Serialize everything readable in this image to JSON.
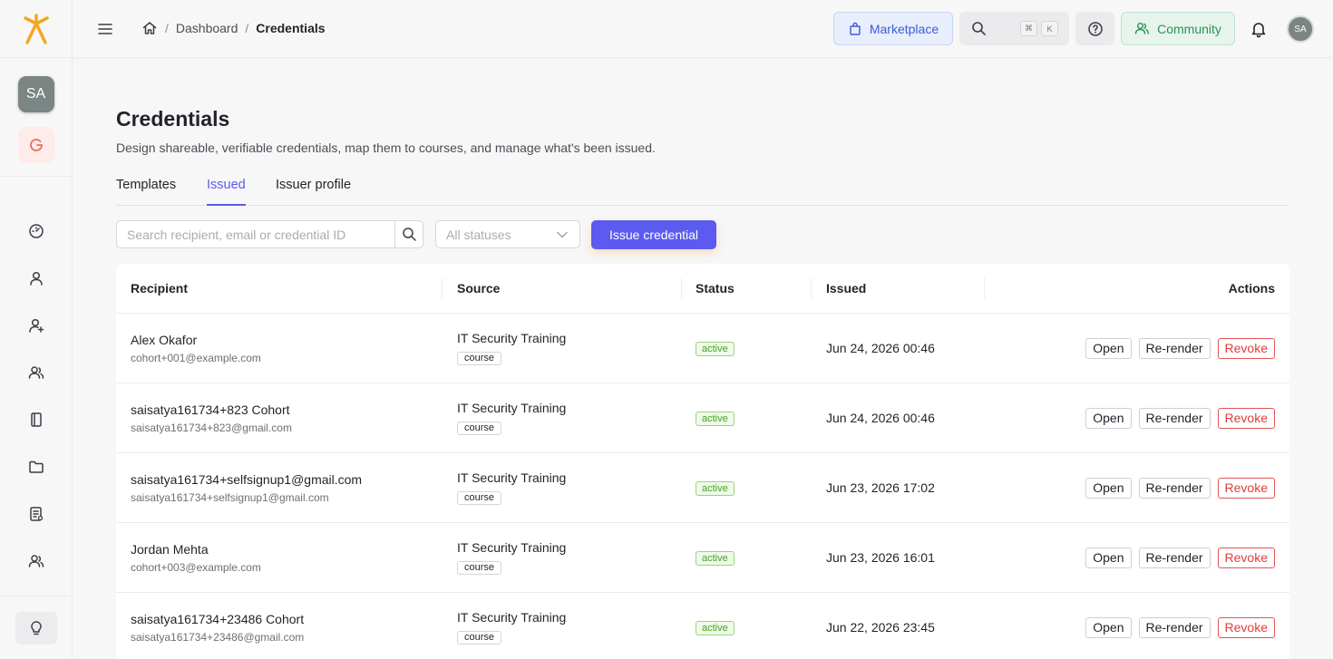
{
  "sidebar": {
    "org_initials": "SA",
    "nav_icons": [
      "dashboard-icon",
      "user-icon",
      "user-add-icon",
      "users-icon",
      "book-icon",
      "folder-icon",
      "report-icon",
      "user-group-icon"
    ]
  },
  "header": {
    "breadcrumb": {
      "home": "home-icon",
      "dashboard": "Dashboard",
      "current": "Credentials"
    },
    "marketplace_label": "Marketplace",
    "shortcut_keys": [
      "⌘",
      "K"
    ],
    "community_label": "Community",
    "user_initials": "SA"
  },
  "page": {
    "title": "Credentials",
    "subtitle": "Design shareable, verifiable credentials, map them to courses, and manage what's been issued.",
    "tabs": [
      {
        "label": "Templates",
        "active": false
      },
      {
        "label": "Issued",
        "active": true
      },
      {
        "label": "Issuer profile",
        "active": false
      }
    ],
    "search_placeholder": "Search recipient, email or credential ID",
    "status_filter": "All statuses",
    "issue_button": "Issue credential"
  },
  "table": {
    "columns": [
      "Recipient",
      "Source",
      "Status",
      "Issued",
      "Actions"
    ],
    "action_labels": {
      "open": "Open",
      "rerender": "Re-render",
      "revoke": "Revoke"
    },
    "rows": [
      {
        "name": "Alex Okafor",
        "email": "cohort+001@example.com",
        "source": "IT Security Training",
        "source_type": "course",
        "status": "active",
        "issued": "Jun 24, 2026 00:46"
      },
      {
        "name": "saisatya161734+823 Cohort",
        "email": "saisatya161734+823@gmail.com",
        "source": "IT Security Training",
        "source_type": "course",
        "status": "active",
        "issued": "Jun 24, 2026 00:46"
      },
      {
        "name": "saisatya161734+selfsignup1@gmail.com",
        "email": "saisatya161734+selfsignup1@gmail.com",
        "source": "IT Security Training",
        "source_type": "course",
        "status": "active",
        "issued": "Jun 23, 2026 17:02"
      },
      {
        "name": "Jordan Mehta",
        "email": "cohort+003@example.com",
        "source": "IT Security Training",
        "source_type": "course",
        "status": "active",
        "issued": "Jun 23, 2026 16:01"
      },
      {
        "name": "saisatya161734+23486 Cohort",
        "email": "saisatya161734+23486@gmail.com",
        "source": "IT Security Training",
        "source_type": "course",
        "status": "active",
        "issued": "Jun 22, 2026 23:45"
      }
    ]
  },
  "colors": {
    "accent": "#5b5bf0",
    "brand_logo": "#f5a623",
    "active_status": "#43a322",
    "revoke": "#e03c3c"
  }
}
